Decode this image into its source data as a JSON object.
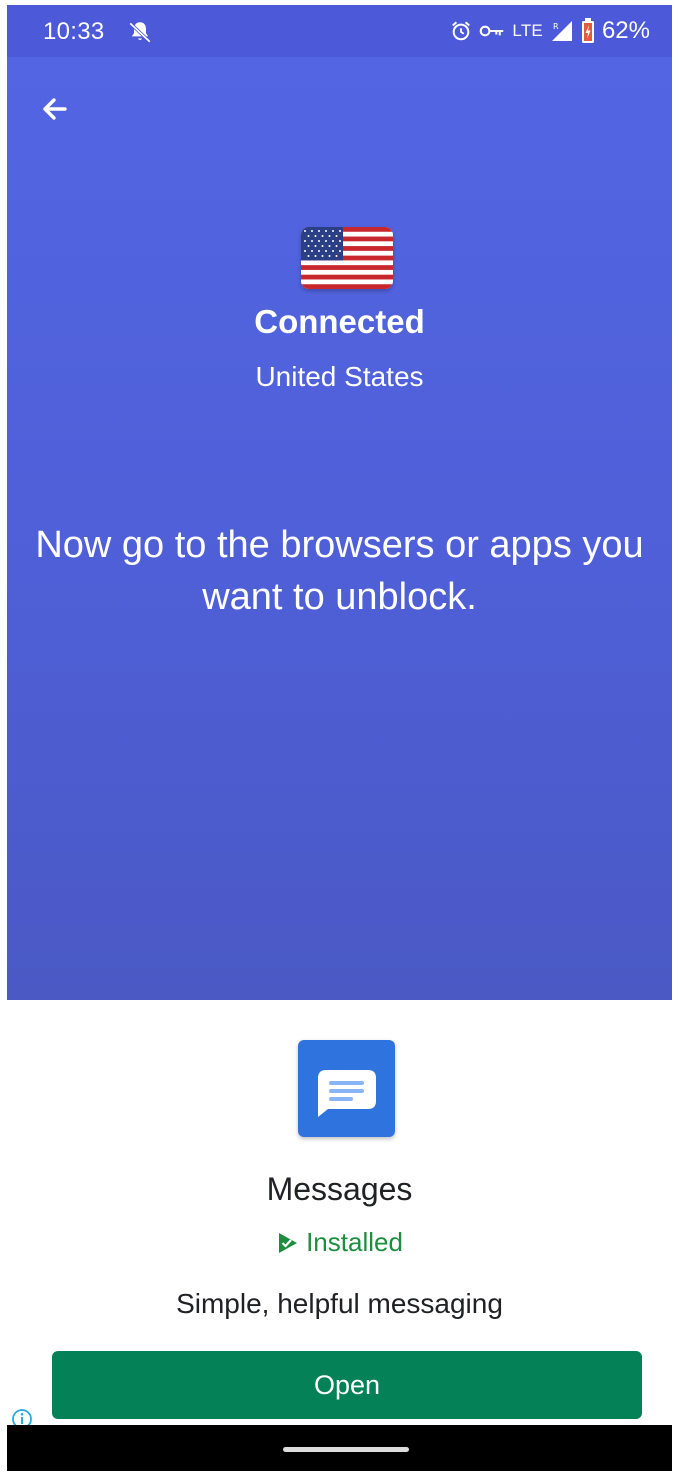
{
  "status_bar": {
    "time": "10:33",
    "network": "LTE",
    "battery": "62%",
    "icons": [
      "do-not-disturb-off-icon",
      "alarm-icon",
      "vpn-key-icon",
      "signal-icon",
      "battery-icon"
    ]
  },
  "vpn": {
    "status": "Connected",
    "country": "United States",
    "flag": "us-flag-icon",
    "message": "Now go to the browsers or apps you want to unblock."
  },
  "ad": {
    "app_name": "Messages",
    "installed_label": "Installed",
    "tagline": "Simple, helpful messaging",
    "open_label": "Open"
  },
  "colors": {
    "primary": "#4c59d8",
    "install_green": "#1e8e3e",
    "button_green": "#058157",
    "app_icon_blue": "#2f74de"
  }
}
